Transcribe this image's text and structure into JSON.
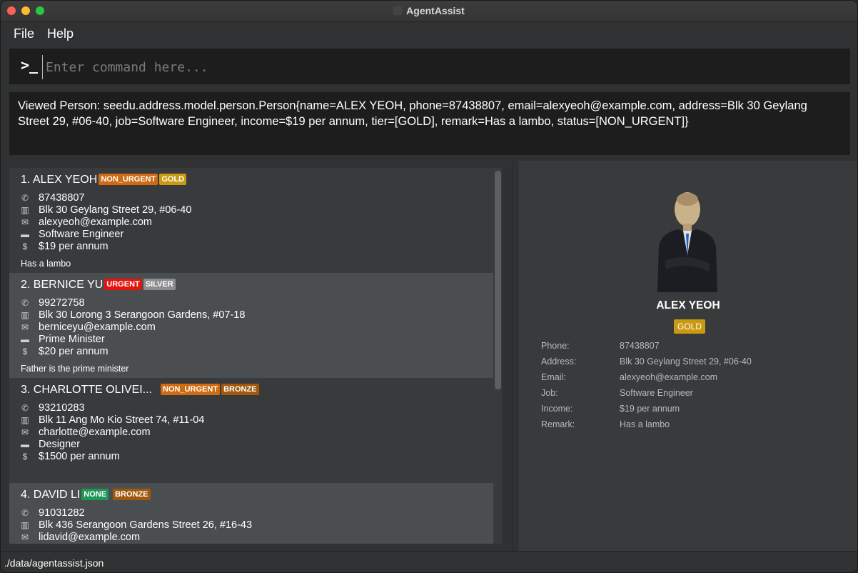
{
  "window": {
    "title": "AgentAssist"
  },
  "menu": {
    "file": "File",
    "help": "Help"
  },
  "command": {
    "prompt": ">_",
    "placeholder": "Enter command here..."
  },
  "result": {
    "text": "Viewed Person: seedu.address.model.person.Person{name=ALEX YEOH, phone=87438807, email=alexyeoh@example.com, address=Blk 30 Geylang Street 29, #06-40, job=Software Engineer, income=$19 per annum, tier=[GOLD], remark=Has a lambo, status=[NON_URGENT]}"
  },
  "persons": [
    {
      "name": "1. ALEX YEOH",
      "status": "NON_URGENT",
      "tier": "GOLD",
      "phone": "87438807",
      "address": "Blk 30 Geylang Street 29, #06-40",
      "email": "alexyeoh@example.com",
      "job": "Software Engineer",
      "income": "$19 per annum",
      "remark": "Has a lambo"
    },
    {
      "name": "2. BERNICE YU",
      "status": "URGENT",
      "tier": "SILVER",
      "phone": "99272758",
      "address": "Blk 30 Lorong 3 Serangoon Gardens, #07-18",
      "email": "berniceyu@example.com",
      "job": "Prime Minister",
      "income": "$20 per annum",
      "remark": "Father is the prime minister"
    },
    {
      "name": "3. CHARLOTTE OLIVEI...",
      "status": "NON_URGENT",
      "tier": "BRONZE",
      "phone": "93210283",
      "address": "Blk 11 Ang Mo Kio Street 74, #11-04",
      "email": "charlotte@example.com",
      "job": "Designer",
      "income": "$1500 per annum",
      "remark": ""
    },
    {
      "name": "4. DAVID LI",
      "status": "NONE",
      "tier": "BRONZE",
      "phone": "91031282",
      "address": "Blk 436 Serangoon Gardens Street 26, #16-43",
      "email": "lidavid@example.com"
    }
  ],
  "detail": {
    "name": "ALEX YEOH",
    "tier": "GOLD",
    "labels": {
      "phone": "Phone:",
      "address": "Address:",
      "email": "Email:",
      "job": "Job:",
      "income": "Income:",
      "remark": "Remark:"
    },
    "values": {
      "phone": "87438807",
      "address": "Blk 30 Geylang Street 29, #06-40",
      "email": "alexyeoh@example.com",
      "job": "Software Engineer",
      "income": "$19 per annum",
      "remark": "Has a lambo"
    }
  },
  "status_bar": {
    "path": "./data/agentassist.json"
  },
  "colors": {
    "gold": "#c99a10",
    "silver": "#8d8d8d",
    "bronze": "#a0580e",
    "urgent": "#e3140e",
    "non_urgent": "#d06a13",
    "none": "#1a9a55"
  }
}
